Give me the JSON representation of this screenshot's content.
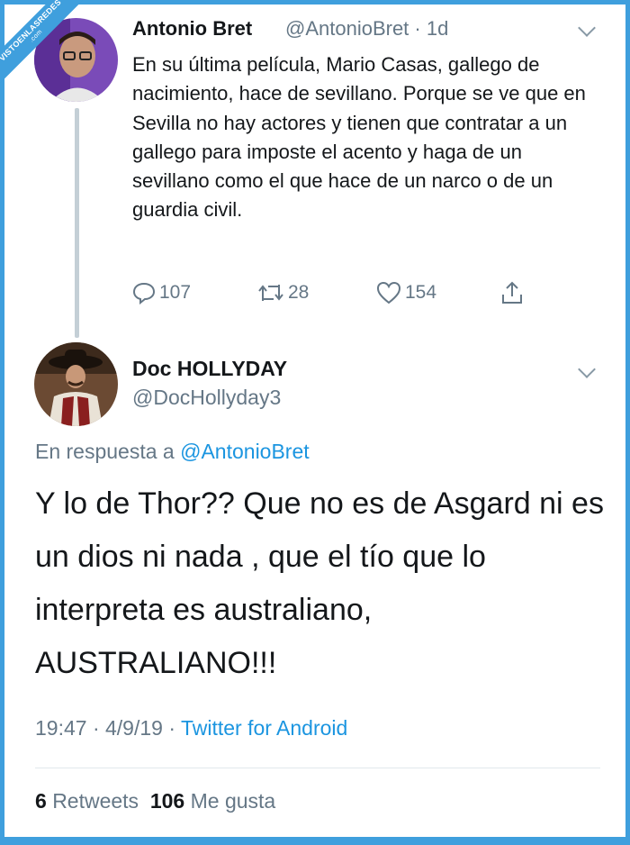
{
  "watermark": {
    "line1": "VISTOENLASREDES",
    "line2": ".com"
  },
  "tweet_parent": {
    "author_name": "Antonio Bret",
    "author_handle": "@AntonioBret · 1d",
    "text": "En su última película, Mario Casas, gallego de nacimiento, hace de sevillano. Porque se ve que en Sevilla no hay actores y tienen que contratar a un gallego para imposte el acento y haga de un sevillano como el que hace de un narco o de un guardia civil.",
    "replies": "107",
    "retweets": "28",
    "likes": "154"
  },
  "tweet_reply": {
    "author_name": "Doc HOLLYDAY",
    "author_handle": "@DocHollyday3",
    "reply_prefix": "En respuesta a",
    "reply_mention": "@AntonioBret",
    "text": "Y lo de Thor?? Que no es de Asgard ni es un dios ni nada , que el tío que lo interpreta es australiano, AUSTRALIANO!!!",
    "time_date": "19:47 · 4/9/19 · ",
    "source": "Twitter for Android",
    "retweet_count": "6",
    "retweet_label": "Retweets",
    "like_count": "106",
    "like_label": "Me gusta"
  },
  "colors": {
    "accent": "#1b95e0",
    "muted": "#657786",
    "frame": "#3f9fdd"
  },
  "icons": [
    "reply-icon",
    "retweet-icon",
    "like-icon",
    "share-icon",
    "chevron-down-icon"
  ]
}
